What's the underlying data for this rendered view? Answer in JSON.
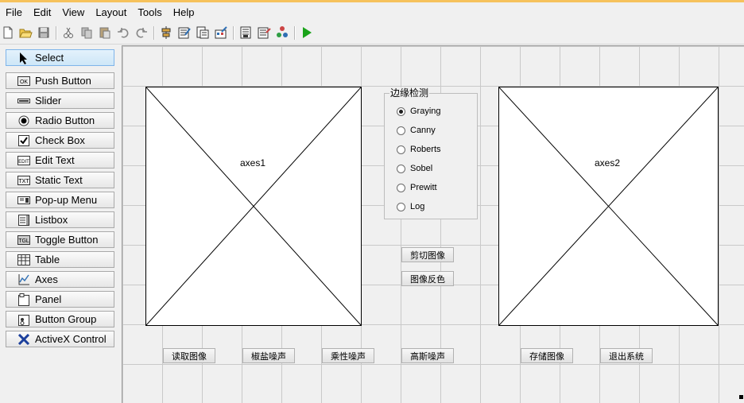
{
  "menu": [
    "File",
    "Edit",
    "View",
    "Layout",
    "Tools",
    "Help"
  ],
  "toolbar": {
    "icons": [
      "new-file-icon",
      "open-folder-icon",
      "save-icon",
      "cut-icon",
      "copy-icon",
      "paste-icon",
      "undo-icon",
      "redo-icon",
      "align-icon",
      "menu-editor-icon",
      "tab-order-icon",
      "toolbar-editor-icon",
      "m-file-editor-icon",
      "property-inspector-icon",
      "object-browser-icon",
      "run-icon"
    ]
  },
  "palette": [
    {
      "label": "Select",
      "icon": "pointer-icon"
    },
    {
      "label": "Push Button",
      "icon": "push-button-icon",
      "badge": "OK"
    },
    {
      "label": "Slider",
      "icon": "slider-icon"
    },
    {
      "label": "Radio Button",
      "icon": "radio-button-icon"
    },
    {
      "label": "Check Box",
      "icon": "check-box-icon"
    },
    {
      "label": "Edit Text",
      "icon": "edit-text-icon",
      "badge": "EDIT"
    },
    {
      "label": "Static Text",
      "icon": "static-text-icon",
      "badge": "TXT"
    },
    {
      "label": "Pop-up Menu",
      "icon": "popup-menu-icon"
    },
    {
      "label": "Listbox",
      "icon": "listbox-icon"
    },
    {
      "label": "Toggle Button",
      "icon": "toggle-button-icon",
      "badge": "TGL"
    },
    {
      "label": "Table",
      "icon": "table-icon"
    },
    {
      "label": "Axes",
      "icon": "axes-icon"
    },
    {
      "label": "Panel",
      "icon": "panel-icon"
    },
    {
      "label": "Button Group",
      "icon": "button-group-icon"
    },
    {
      "label": "ActiveX Control",
      "icon": "activex-icon"
    }
  ],
  "canvas": {
    "axes1": {
      "label": "axes1"
    },
    "axes2": {
      "label": "axes2"
    },
    "panel": {
      "title": "边缘检测",
      "options": [
        {
          "label": "Graying",
          "selected": true
        },
        {
          "label": "Canny",
          "selected": false
        },
        {
          "label": "Roberts",
          "selected": false
        },
        {
          "label": "Sobel",
          "selected": false
        },
        {
          "label": "Prewitt",
          "selected": false
        },
        {
          "label": "Log",
          "selected": false
        }
      ]
    },
    "mid_buttons": [
      "剪切图像",
      "图像反色"
    ],
    "bottom_buttons": [
      "读取图像",
      "椒盐噪声",
      "乘性噪声",
      "高斯噪声",
      "存储图像",
      "退出系统"
    ]
  },
  "colors": {
    "accent": "#f6c25c",
    "run": "#1aa31a",
    "selected": "#cde6f7"
  }
}
